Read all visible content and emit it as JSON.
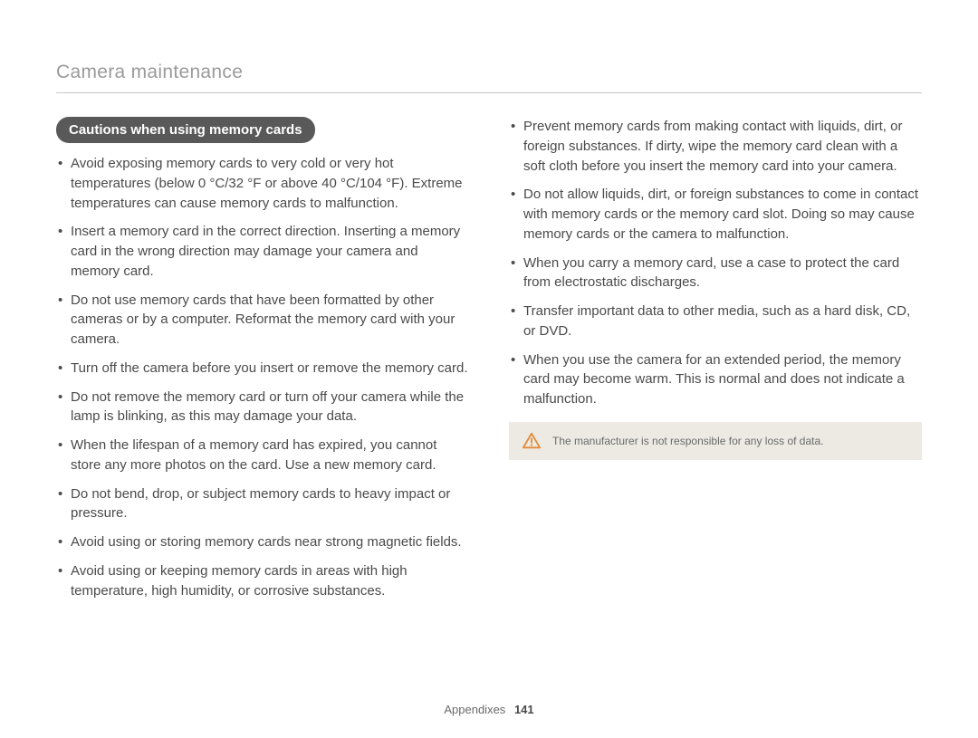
{
  "header": {
    "title": "Camera maintenance"
  },
  "section": {
    "badge": "Cautions when using memory cards"
  },
  "left_bullets": [
    "Avoid exposing memory cards to very cold or very hot temperatures (below 0 °C/32 °F or above 40 °C/104 °F). Extreme temperatures can cause memory cards to malfunction.",
    "Insert a memory card in the correct direction. Inserting a memory card in the wrong direction may damage your camera and memory card.",
    "Do not use memory cards that have been formatted by other cameras or by a computer. Reformat the memory card with your camera.",
    "Turn off the camera before you insert or remove the memory card.",
    "Do not remove the memory card or turn off your camera while the lamp is blinking, as this may damage your data.",
    "When the lifespan of a memory card has expired, you cannot store any more photos on the card. Use a new memory card.",
    "Do not bend, drop, or subject memory cards to heavy impact or pressure.",
    "Avoid using or storing memory cards near strong magnetic fields.",
    "Avoid using or keeping memory cards in areas with high temperature, high humidity, or corrosive substances."
  ],
  "right_bullets": [
    "Prevent memory cards from making contact with liquids, dirt, or foreign substances. If dirty, wipe the memory card clean with a soft cloth before you insert the memory card into your camera.",
    "Do not allow liquids, dirt, or foreign substances to come in contact with memory cards or the memory card slot. Doing so may cause memory cards or the camera to malfunction.",
    "When you carry a memory card, use a case to protect the card from electrostatic discharges.",
    "Transfer important data to other media, such as a hard disk, CD, or DVD.",
    "When you use the camera for an extended period, the memory card may become warm. This is normal and does not indicate a malfunction."
  ],
  "notice": {
    "text": "The manufacturer is not responsible for any loss of data."
  },
  "footer": {
    "section": "Appendixes",
    "page": "141"
  }
}
